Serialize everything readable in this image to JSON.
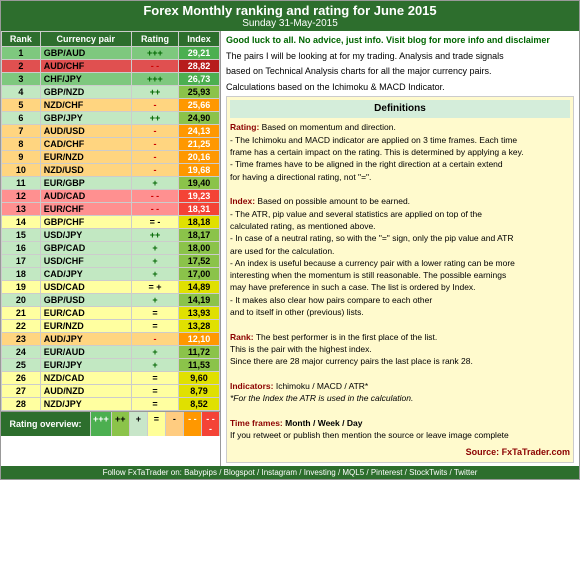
{
  "header": {
    "title": "Forex Monthly ranking and rating for June 2015",
    "subtitle": "Sunday 31-May-2015"
  },
  "table": {
    "columns": [
      "Rank",
      "Currency pair",
      "Rating",
      "Index"
    ],
    "rows": [
      {
        "rank": 1,
        "pair": "GBP/AUD",
        "rating": "+++",
        "rating_type": "plus",
        "index": "29,21",
        "row_color": "row-green",
        "idx_color": "idx-green"
      },
      {
        "rank": 2,
        "pair": "AUD/CHF",
        "rating": "- -",
        "rating_type": "minus",
        "index": "28,82",
        "row_color": "row-dark-red",
        "idx_color": "idx-dark-red"
      },
      {
        "rank": 3,
        "pair": "CHF/JPY",
        "rating": "+++",
        "rating_type": "plus",
        "index": "26,73",
        "row_color": "row-green",
        "idx_color": "idx-green"
      },
      {
        "rank": 4,
        "pair": "GBP/NZD",
        "rating": "++",
        "rating_type": "plus",
        "index": "25,93",
        "row_color": "row-light-green",
        "idx_color": "idx-light-green"
      },
      {
        "rank": 5,
        "pair": "NZD/CHF",
        "rating": "-",
        "rating_type": "minus",
        "index": "25,66",
        "row_color": "row-orange",
        "idx_color": "idx-orange"
      },
      {
        "rank": 6,
        "pair": "GBP/JPY",
        "rating": "++",
        "rating_type": "plus",
        "index": "24,90",
        "row_color": "row-light-green",
        "idx_color": "idx-light-green"
      },
      {
        "rank": 7,
        "pair": "AUD/USD",
        "rating": "-",
        "rating_type": "minus",
        "index": "24,13",
        "row_color": "row-orange",
        "idx_color": "idx-orange"
      },
      {
        "rank": 8,
        "pair": "CAD/CHF",
        "rating": "-",
        "rating_type": "minus",
        "index": "21,25",
        "row_color": "row-orange",
        "idx_color": "idx-orange"
      },
      {
        "rank": 9,
        "pair": "EUR/NZD",
        "rating": "-",
        "rating_type": "minus",
        "index": "20,16",
        "row_color": "row-orange",
        "idx_color": "idx-orange"
      },
      {
        "rank": 10,
        "pair": "NZD/USD",
        "rating": "-",
        "rating_type": "minus",
        "index": "19,68",
        "row_color": "row-orange",
        "idx_color": "idx-orange"
      },
      {
        "rank": 11,
        "pair": "EUR/GBP",
        "rating": "+",
        "rating_type": "plus",
        "index": "19,40",
        "row_color": "row-light-green",
        "idx_color": "idx-light-green"
      },
      {
        "rank": 12,
        "pair": "AUD/CAD",
        "rating": "- -",
        "rating_type": "minus",
        "index": "19,23",
        "row_color": "row-red",
        "idx_color": "idx-red"
      },
      {
        "rank": 13,
        "pair": "EUR/CHF",
        "rating": "- -",
        "rating_type": "minus",
        "index": "18,31",
        "row_color": "row-red",
        "idx_color": "idx-red"
      },
      {
        "rank": 14,
        "pair": "GBP/CHF",
        "rating": "= -",
        "rating_type": "neutral",
        "index": "18,18",
        "row_color": "row-yellow",
        "idx_color": "idx-yellow"
      },
      {
        "rank": 15,
        "pair": "USD/JPY",
        "rating": "++",
        "rating_type": "plus",
        "index": "18,17",
        "row_color": "row-light-green",
        "idx_color": "idx-light-green"
      },
      {
        "rank": 16,
        "pair": "GBP/CAD",
        "rating": "+",
        "rating_type": "plus",
        "index": "18,00",
        "row_color": "row-light-green",
        "idx_color": "idx-light-green"
      },
      {
        "rank": 17,
        "pair": "USD/CHF",
        "rating": "+",
        "rating_type": "plus",
        "index": "17,52",
        "row_color": "row-light-green",
        "idx_color": "idx-light-green"
      },
      {
        "rank": 18,
        "pair": "CAD/JPY",
        "rating": "+",
        "rating_type": "plus",
        "index": "17,00",
        "row_color": "row-light-green",
        "idx_color": "idx-light-green"
      },
      {
        "rank": 19,
        "pair": "USD/CAD",
        "rating": "= +",
        "rating_type": "neutral",
        "index": "14,89",
        "row_color": "row-yellow",
        "idx_color": "idx-yellow"
      },
      {
        "rank": 20,
        "pair": "GBP/USD",
        "rating": "+",
        "rating_type": "plus",
        "index": "14,19",
        "row_color": "row-light-green",
        "idx_color": "idx-light-green"
      },
      {
        "rank": 21,
        "pair": "EUR/CAD",
        "rating": "=",
        "rating_type": "neutral",
        "index": "13,93",
        "row_color": "row-yellow",
        "idx_color": "idx-yellow"
      },
      {
        "rank": 22,
        "pair": "EUR/NZD",
        "rating": "=",
        "rating_type": "neutral",
        "index": "13,28",
        "row_color": "row-yellow",
        "idx_color": "idx-yellow"
      },
      {
        "rank": 23,
        "pair": "AUD/JPY",
        "rating": "-",
        "rating_type": "minus",
        "index": "12,10",
        "row_color": "row-orange",
        "idx_color": "idx-orange"
      },
      {
        "rank": 24,
        "pair": "EUR/AUD",
        "rating": "+",
        "rating_type": "plus",
        "index": "11,72",
        "row_color": "row-light-green",
        "idx_color": "idx-light-green"
      },
      {
        "rank": 25,
        "pair": "EUR/JPY",
        "rating": "+",
        "rating_type": "plus",
        "index": "11,53",
        "row_color": "row-light-green",
        "idx_color": "idx-light-green"
      },
      {
        "rank": 26,
        "pair": "NZD/CAD",
        "rating": "=",
        "rating_type": "neutral",
        "index": "9,60",
        "row_color": "row-yellow",
        "idx_color": "idx-yellow"
      },
      {
        "rank": 27,
        "pair": "AUD/NZD",
        "rating": "=",
        "rating_type": "neutral",
        "index": "8,79",
        "row_color": "row-yellow",
        "idx_color": "idx-yellow"
      },
      {
        "rank": 28,
        "pair": "NZD/JPY",
        "rating": "=",
        "rating_type": "neutral",
        "index": "8,52",
        "row_color": "row-yellow",
        "idx_color": "idx-yellow"
      }
    ]
  },
  "rating_overview": {
    "label": "Rating overview:",
    "items": [
      {
        "label": "+++",
        "color": "rc-ggg"
      },
      {
        "label": "++",
        "color": "rc-gg"
      },
      {
        "label": "+",
        "color": "rc-g"
      },
      {
        "label": "=",
        "color": "rc-eq"
      },
      {
        "label": "-",
        "color": "rc-m"
      },
      {
        "label": "- -",
        "color": "rc-mm"
      },
      {
        "label": "- - -",
        "color": "rc-mmm"
      }
    ]
  },
  "right": {
    "intro": "Good luck to all. No advice, just info. Visit blog for more info and disclaimer",
    "line1": "The pairs I will be looking at for my trading. Analysis and trade signals",
    "line2": "based on Technical Analysis charts for all the major currency pairs.",
    "line3": "Calculations based on the Ichimoku & MACD Indicator.",
    "definitions_title": "Definitions",
    "def_rating_title": "Rating:",
    "def_rating_text": "Based on momentum and direction.",
    "def_rating_detail1": "- The Ichimoku and MACD indicator are applied on 3 time frames. Each time",
    "def_rating_detail2": "frame has a certain impact on the rating. This is determined by applying a key.",
    "def_rating_detail3": "- Time frames have to be aligned in the right direction at a certain extend",
    "def_rating_detail4": "for having a directional rating, not \"=\".",
    "def_index_title": "Index:",
    "def_index_text": "Based on possible amount to be earned.",
    "def_index_detail1": "- The ATR, pip value and several statistics are applied on top of the",
    "def_index_detail2": "calculated rating, as mentioned above.",
    "def_index_detail3": "- In case of a neutral rating, so with the \"=\" sign, only the pip value and ATR",
    "def_index_detail4": "are used for the calculation.",
    "def_index_detail5": "- An index is useful because a currency pair with a lower rating can be more",
    "def_index_detail6": "interesting when the momentum is still reasonable. The possible earnings",
    "def_index_detail7": "may have preference in such a case. The list is ordered by Index.",
    "def_compare1": "- It makes also clear how pairs compare to each other",
    "def_compare2": "and to itself in other (previous) lists.",
    "def_rank_title": "Rank:",
    "def_rank_text": "The best performer is in the first place of the list.",
    "def_rank_detail1": "This is the pair with the highest index.",
    "def_rank_detail2": "Since there are 28 major currency pairs the last place is rank 28.",
    "def_indicators_title": "Indicators:",
    "def_indicators_text": "Ichimoku / MACD / ATR*",
    "def_indicators_note": "*For the Index the ATR is used in the calculation.",
    "def_timeframes_title": "Time frames:",
    "def_timeframes_text": "Month / Week / Day",
    "def_retweet": "If you retweet or publish then mention the source or leave image complete",
    "source": "Source: FxTaTrader.com"
  },
  "footer": {
    "text": "Follow FxTaTrader on: Babypips / Blogspot / Instagram / Investing / MQL5 / Pinterest / StockTwits / Twitter"
  }
}
